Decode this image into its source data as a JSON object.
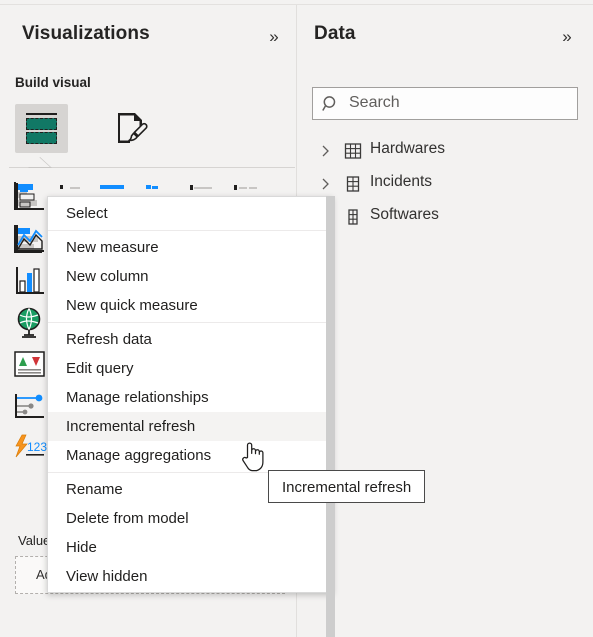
{
  "visualizations": {
    "title": "Visualizations",
    "collapse_icon": "chevron-double-right-icon",
    "collapse_glyph": "»",
    "build_visual_label": "Build visual",
    "tabs": [
      {
        "name": "fields",
        "icon": "table-fields-icon",
        "selected": true
      },
      {
        "name": "format",
        "icon": "paint-brush-page-icon",
        "selected": false
      }
    ],
    "gallery": [
      "stacked-bar-chart-icon",
      "stacked-column-chart-icon",
      "clustered-bar-chart-icon",
      "clustered-column-chart-icon",
      "hundred-percent-stacked-bar-icon",
      "hundred-percent-stacked-column-icon",
      "line-chart-icon",
      "area-chart-icon",
      "stacked-area-chart-icon",
      "line-stacked-column-icon",
      "line-clustered-column-icon",
      "ribbon-chart-icon",
      "waterfall-chart-icon",
      "funnel-chart-icon",
      "scatter-chart-icon",
      "pie-chart-icon",
      "donut-chart-icon",
      "treemap-icon",
      "map-icon",
      "filled-map-icon",
      "shape-map-icon",
      "azure-map-icon",
      "gauge-icon",
      "card-icon",
      "multi-row-card-icon",
      "kpi-icon",
      "slicer-icon",
      "table-icon",
      "matrix-icon",
      "r-script-visual-icon",
      "python-visual-icon",
      "key-influencers-icon",
      "decomposition-tree-icon",
      "qna-icon",
      "smart-narrative-icon",
      "metrics-icon",
      "paginated-report-icon",
      "power-apps-icon",
      "get-more-visuals-icon"
    ],
    "well": {
      "label": "Values",
      "label_visible": "Val",
      "placeholder": "Add data fields here",
      "placeholder_visible": "Ad"
    }
  },
  "data": {
    "title": "Data",
    "collapse_icon": "chevron-double-right-icon",
    "collapse_glyph": "»",
    "search": {
      "placeholder": "Search",
      "value": "",
      "icon": "search-icon"
    },
    "tables": [
      {
        "label": "Hardwares",
        "expanded": false,
        "chevron": "chevron-right-icon",
        "icon": "table-icon"
      },
      {
        "label": "Incidents",
        "expanded": false,
        "chevron": "chevron-right-icon",
        "icon": "table-icon"
      },
      {
        "label": "Softwares",
        "expanded": false,
        "chevron": "chevron-right-icon",
        "icon": "table-icon"
      }
    ]
  },
  "context_menu": {
    "items": [
      {
        "label": "Select",
        "selected": false,
        "sep_after": true
      },
      {
        "label": "New measure",
        "selected": false,
        "sep_after": false
      },
      {
        "label": "New column",
        "selected": false,
        "sep_after": false
      },
      {
        "label": "New quick measure",
        "selected": false,
        "sep_after": true
      },
      {
        "label": "Refresh data",
        "selected": false,
        "sep_after": false
      },
      {
        "label": "Edit query",
        "selected": false,
        "sep_after": false
      },
      {
        "label": "Manage relationships",
        "selected": false,
        "sep_after": false
      },
      {
        "label": "Incremental refresh",
        "selected": true,
        "sep_after": false
      },
      {
        "label": "Manage aggregations",
        "selected": false,
        "sep_after": true
      },
      {
        "label": "Rename",
        "selected": false,
        "sep_after": false
      },
      {
        "label": "Delete from model",
        "selected": false,
        "sep_after": false
      },
      {
        "label": "Hide",
        "selected": false,
        "sep_after": false
      },
      {
        "label": "View hidden",
        "selected": false,
        "sep_after": false
      }
    ]
  },
  "tooltip": {
    "text": "Incremental refresh"
  },
  "cursor": {
    "icon": "hand-pointer-cursor"
  },
  "colors": {
    "panel_bg": "#f3f2f1",
    "menu_bg": "#ffffff",
    "menu_hover": "#f4f3f2",
    "text": "#201f1e",
    "accent_teal": "#117865",
    "accent_blue": "#118dff",
    "border": "#d9d9d9",
    "scrollbar": "#cdcdcd"
  }
}
